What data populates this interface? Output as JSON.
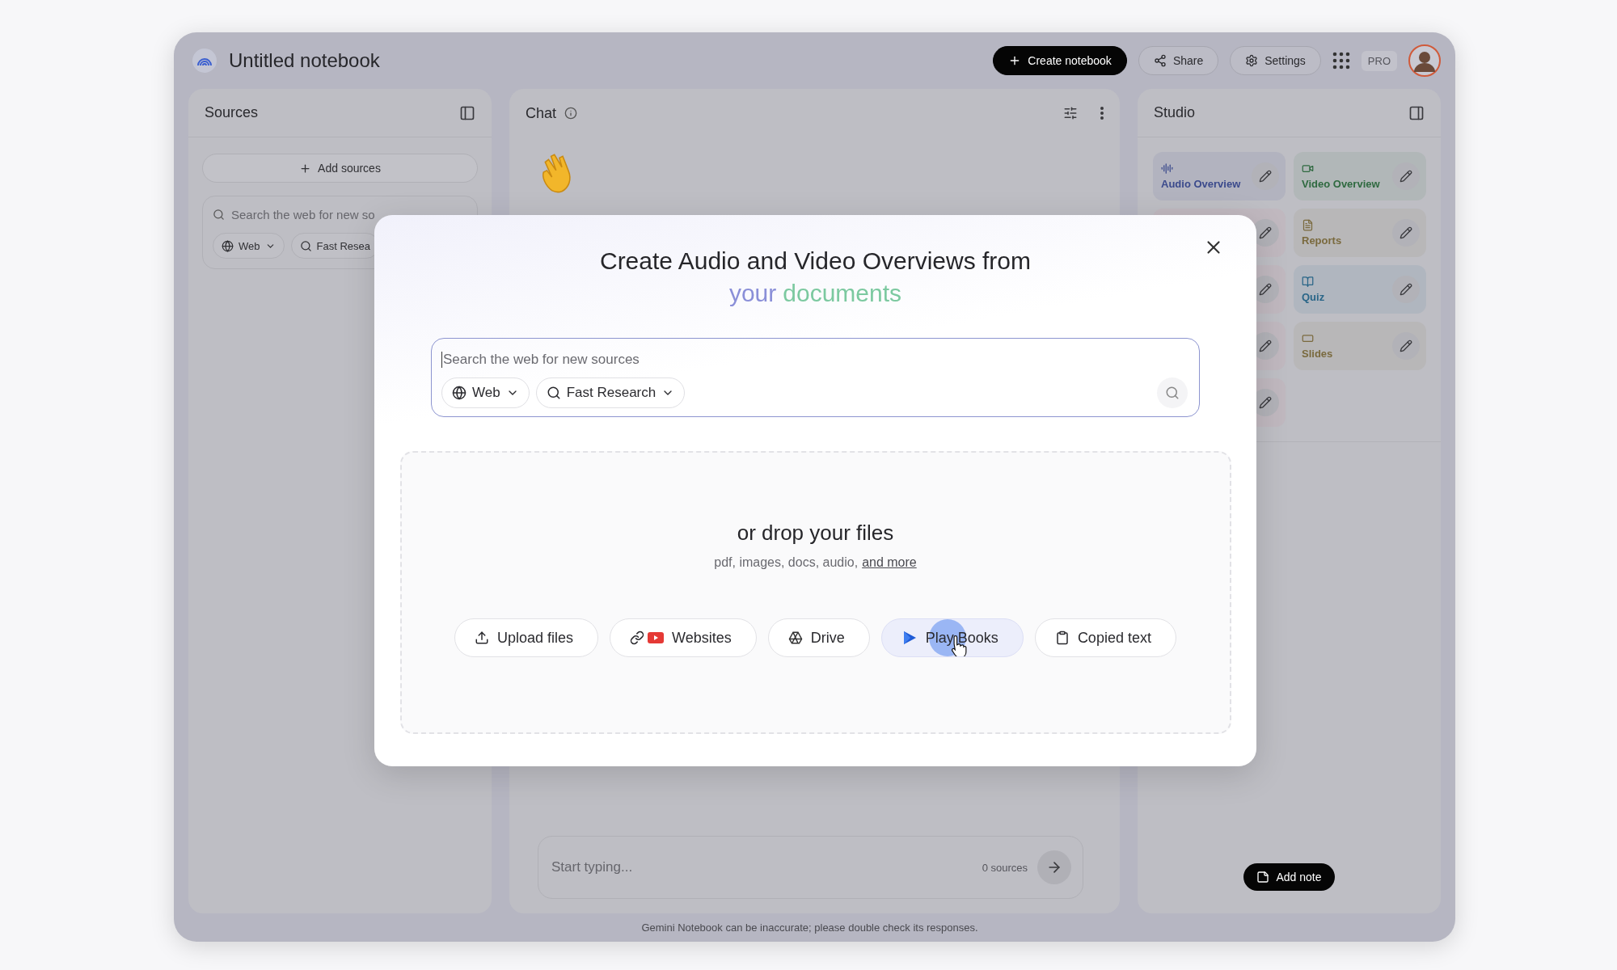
{
  "app": {
    "title": "Untitled notebook",
    "actions": [
      {
        "kind": "primary",
        "label": "Create notebook"
      },
      {
        "kind": "share",
        "label": "Share"
      },
      {
        "kind": "settings",
        "label": "Settings"
      }
    ],
    "badge": "PRO"
  },
  "sources": {
    "title": "Sources",
    "add_button": "Add sources",
    "search_placeholder": "Search the web for new so",
    "chips": [
      {
        "kind": "web",
        "label": "Web"
      },
      {
        "kind": "research",
        "label": "Fast Resea"
      }
    ]
  },
  "chat": {
    "title": "Chat",
    "input_placeholder": "Start typing...",
    "source_count": "0 sources"
  },
  "studio": {
    "title": "Studio",
    "tiles": [
      {
        "kind": "audio",
        "label": "Audio Overview",
        "color": "#3b4a8c"
      },
      {
        "kind": "video",
        "label": "Video Overview",
        "color": "#2f6a40"
      },
      {
        "kind": "covered"
      },
      {
        "kind": "reports",
        "label": "Reports",
        "color": "#7a6a3e"
      },
      {
        "kind": "covered"
      },
      {
        "kind": "quiz",
        "label": "Quiz",
        "color": "#2a6688"
      },
      {
        "kind": "covered"
      },
      {
        "kind": "slides",
        "label": "Slides",
        "color": "#7a6a3e"
      },
      {
        "kind": "covered"
      }
    ],
    "add_note": "Add note"
  },
  "disclaimer": "Gemini Notebook can be inaccurate; please double check its responses.",
  "dialog": {
    "title": "Create Audio and Video Overviews from",
    "highlight": [
      {
        "text": "your",
        "color": "#8a8fd8"
      },
      {
        "text": "documents",
        "color": "#7cc9a0"
      }
    ],
    "search": {
      "placeholder": "Search the web for new sources",
      "chips": [
        {
          "kind": "web",
          "label": "Web"
        },
        {
          "kind": "research",
          "label": "Fast Research"
        }
      ]
    },
    "drop": {
      "title": "or drop your files",
      "hint": "pdf, images, docs, audio,",
      "link": "and more"
    },
    "buttons": [
      {
        "kind": "upload",
        "label": "Upload files",
        "hovered": false
      },
      {
        "kind": "websites",
        "label": "Websites",
        "hovered": false
      },
      {
        "kind": "drive",
        "label": "Drive",
        "hovered": false
      },
      {
        "kind": "playbooks",
        "label": "Play Books",
        "hovered": true
      },
      {
        "kind": "copied",
        "label": "Copied text",
        "hovered": false
      }
    ]
  }
}
